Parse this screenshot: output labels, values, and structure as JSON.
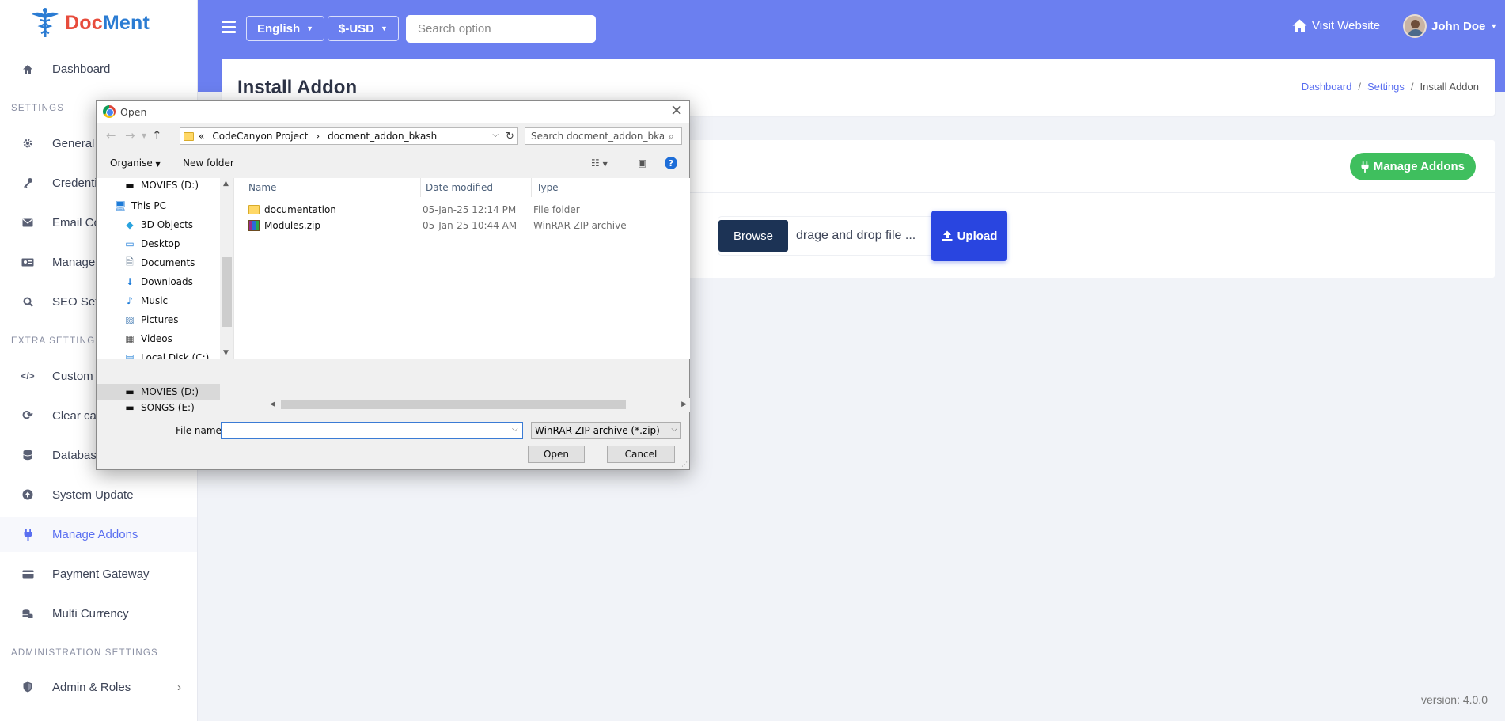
{
  "app": {
    "logo_doc": "Doc",
    "logo_ment": "Ment"
  },
  "sidebar": {
    "dashboard": "Dashboard",
    "section_settings": "SETTINGS",
    "items_settings": [
      {
        "label": "General",
        "icon": "gear-icon"
      },
      {
        "label": "Credenti",
        "icon": "key-icon"
      },
      {
        "label": "Email Co",
        "icon": "envelope-icon"
      },
      {
        "label": "Manage",
        "icon": "id-card-icon"
      },
      {
        "label": "SEO Setu",
        "icon": "search-icon"
      }
    ],
    "section_extra": "EXTRA SETTINGS",
    "items_extra": [
      {
        "label": "Custom C",
        "icon": "code-icon"
      },
      {
        "label": "Clear cac",
        "icon": "refresh-icon"
      },
      {
        "label": "Databas",
        "icon": "database-icon"
      },
      {
        "label": "System Update",
        "icon": "upload-circle-icon"
      },
      {
        "label": "Manage Addons",
        "icon": "plug-icon",
        "active": true
      },
      {
        "label": "Payment Gateway",
        "icon": "credit-card-icon"
      },
      {
        "label": "Multi Currency",
        "icon": "coins-icon"
      }
    ],
    "section_admin": "ADMINISTRATION SETTINGS",
    "admin_roles": "Admin & Roles"
  },
  "header": {
    "language": "English",
    "currency": "$-USD",
    "search_placeholder": "Search option",
    "visit_website": "Visit Website",
    "user_name": "John Doe"
  },
  "page": {
    "title": "Install Addon",
    "breadcrumb": [
      "Dashboard",
      "Settings",
      "Install Addon"
    ],
    "manage_addons_button": "Manage Addons",
    "browse_button": "Browse",
    "drop_text": "drage and drop file ...",
    "upload_button": "Upload"
  },
  "footer": {
    "version": "version: 4.0.0"
  },
  "dialog": {
    "title": "Open",
    "path": [
      "«",
      "CodeCanyon Project",
      "›",
      "docment_addon_bkash"
    ],
    "search_placeholder": "Search docment_addon_bkash",
    "organise": "Organise",
    "new_folder": "New folder",
    "tree": [
      {
        "label": "MOVIES (D:)",
        "icon": "drive-icon"
      },
      {
        "label": "This PC",
        "icon": "computer-icon"
      },
      {
        "label": "3D Objects",
        "icon": "cube-icon"
      },
      {
        "label": "Desktop",
        "icon": "desktop-icon"
      },
      {
        "label": "Documents",
        "icon": "documents-icon"
      },
      {
        "label": "Downloads",
        "icon": "download-icon"
      },
      {
        "label": "Music",
        "icon": "music-icon"
      },
      {
        "label": "Pictures",
        "icon": "picture-icon"
      },
      {
        "label": "Videos",
        "icon": "video-icon"
      },
      {
        "label": "Local Disk (C:)",
        "icon": "disk-icon"
      },
      {
        "label": "MOVIES (D:)",
        "icon": "drive-icon",
        "selected": true
      },
      {
        "label": "SONGS (E:)",
        "icon": "drive-icon"
      }
    ],
    "columns": [
      "Name",
      "Date modified",
      "Type"
    ],
    "files": [
      {
        "name": "documentation",
        "date": "05-Jan-25 12:14 PM",
        "type": "File folder",
        "icon": "folder-icon"
      },
      {
        "name": "Modules.zip",
        "date": "05-Jan-25 10:44 AM",
        "type": "WinRAR ZIP archive",
        "icon": "zip-archive-icon"
      }
    ],
    "file_name_label": "File name:",
    "file_name_value": "",
    "filter": "WinRAR ZIP archive (*.zip)",
    "open_button": "Open",
    "cancel_button": "Cancel"
  },
  "colors": {
    "header_bg": "#6b7ff0",
    "accent": "#5a6ff0",
    "manage_addons_green": "#3fbf5e",
    "upload_blue": "#2945e0",
    "browse_navy": "#1c3355"
  }
}
